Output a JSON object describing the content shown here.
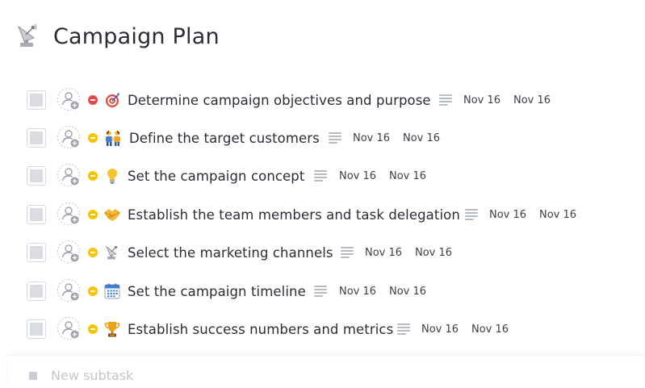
{
  "page": {
    "title": "Campaign Plan",
    "title_icon": "satellite-antenna-icon"
  },
  "tasks": [
    {
      "name": "Determine campaign objectives and purpose",
      "emoji_icon": "direct-hit-target-icon",
      "priority": "urgent",
      "priority_color": "#e5484d",
      "start_date": "Nov 16",
      "due_date": "Nov 16"
    },
    {
      "name": "Define the target customers",
      "emoji_icon": "people-holding-hands-icon",
      "priority": "normal",
      "priority_color": "#f5c400",
      "start_date": "Nov 16",
      "due_date": "Nov 16"
    },
    {
      "name": "Set the campaign concept",
      "emoji_icon": "light-bulb-icon",
      "priority": "normal",
      "priority_color": "#f5c400",
      "start_date": "Nov 16",
      "due_date": "Nov 16"
    },
    {
      "name": "Establish the team members and task delegation",
      "emoji_icon": "handshake-icon",
      "priority": "normal",
      "priority_color": "#f5c400",
      "start_date": "Nov 16",
      "due_date": "Nov 16"
    },
    {
      "name": "Select the marketing channels",
      "emoji_icon": "satellite-antenna-icon",
      "priority": "normal",
      "priority_color": "#f5c400",
      "start_date": "Nov 16",
      "due_date": "Nov 16"
    },
    {
      "name": "Set the campaign timeline",
      "emoji_icon": "calendar-icon",
      "priority": "normal",
      "priority_color": "#f5c400",
      "start_date": "Nov 16",
      "due_date": "Nov 16"
    },
    {
      "name": "Establish success numbers and metrics",
      "emoji_icon": "trophy-icon",
      "priority": "normal",
      "priority_color": "#f5c400",
      "start_date": "Nov 16",
      "due_date": "Nov 16"
    }
  ],
  "new_subtask": {
    "placeholder": "New subtask"
  }
}
